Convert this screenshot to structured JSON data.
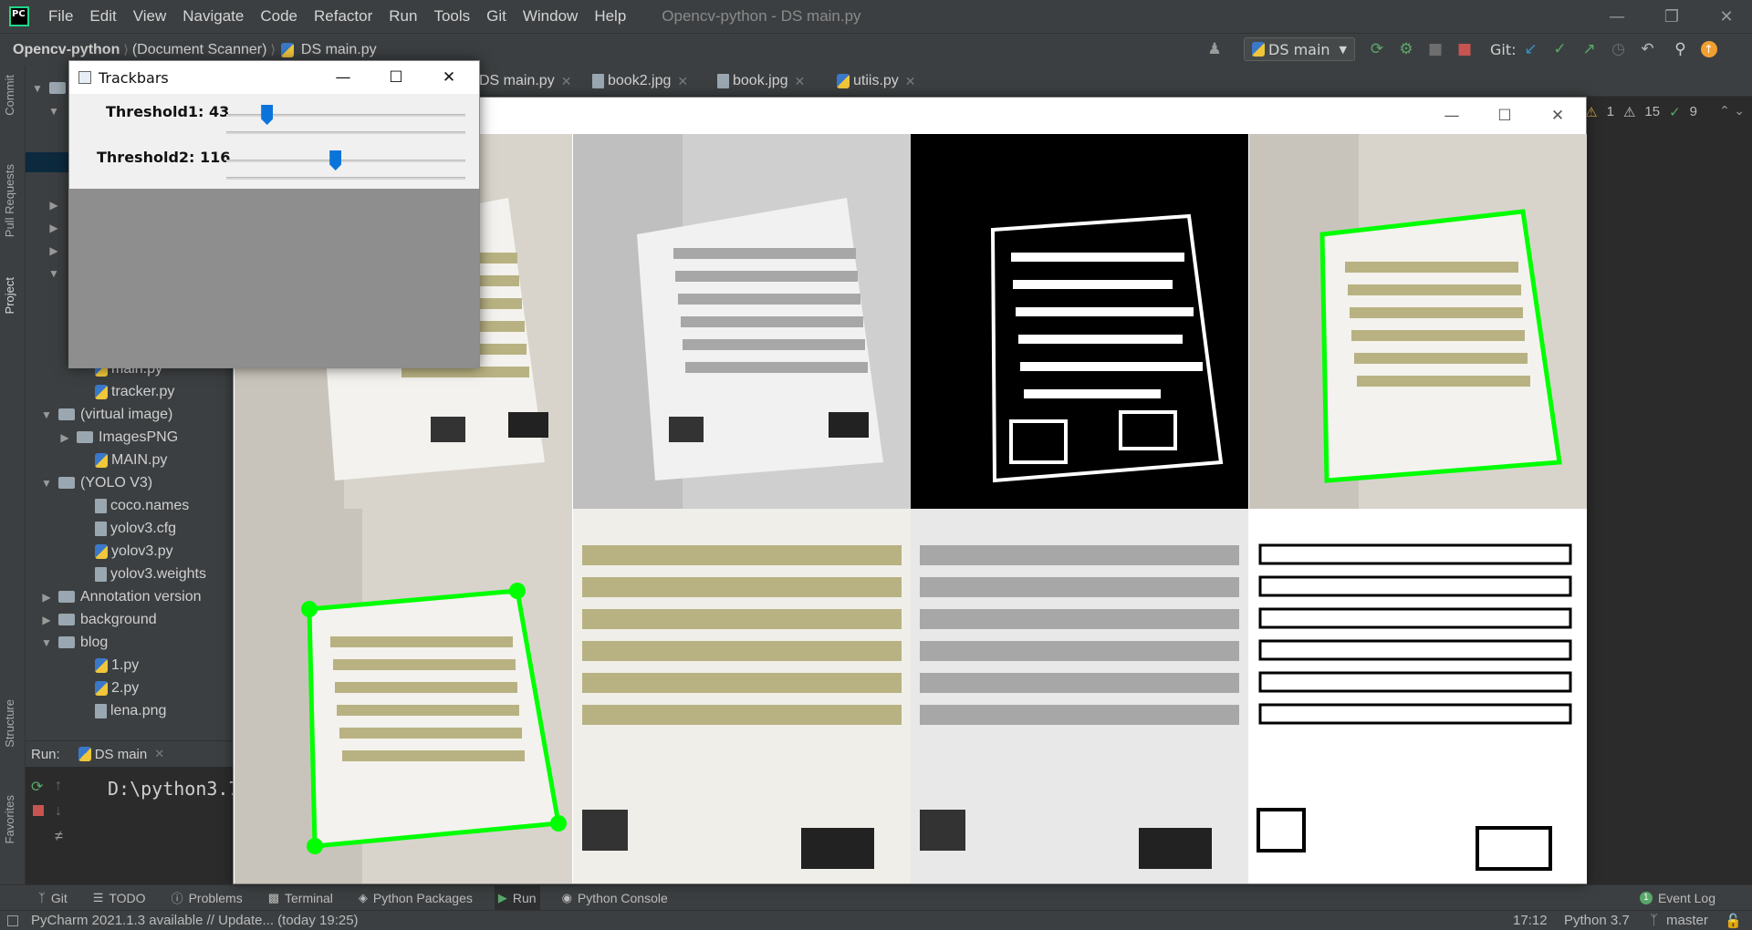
{
  "menubar": {
    "items": [
      "File",
      "Edit",
      "View",
      "Navigate",
      "Code",
      "Refactor",
      "Run",
      "Tools",
      "Git",
      "Window",
      "Help"
    ],
    "title": "Opencv-python - DS main.py"
  },
  "navbar": {
    "crumbs": [
      "Opencv-python",
      "(Document Scanner)",
      "DS main.py"
    ],
    "run_config": "DS main",
    "git_label": "Git:"
  },
  "left_stripe": [
    "Commit",
    "Pull Requests",
    "Project",
    "Structure",
    "Favorites"
  ],
  "tree": {
    "items": [
      {
        "label": "main.py",
        "type": "py",
        "indent": 2
      },
      {
        "label": "tracker.py",
        "type": "py",
        "indent": 2
      },
      {
        "label": "(virtual image)",
        "type": "folder",
        "indent": 1,
        "open": true
      },
      {
        "label": "ImagesPNG",
        "type": "folder",
        "indent": 2,
        "open": false
      },
      {
        "label": "MAIN.py",
        "type": "py",
        "indent": 2
      },
      {
        "label": "(YOLO V3)",
        "type": "folder",
        "indent": 1,
        "open": true
      },
      {
        "label": "coco.names",
        "type": "file",
        "indent": 2
      },
      {
        "label": "yolov3.cfg",
        "type": "file",
        "indent": 2
      },
      {
        "label": "yolov3.py",
        "type": "py",
        "indent": 2
      },
      {
        "label": "yolov3.weights",
        "type": "file",
        "indent": 2
      },
      {
        "label": "Annotation version",
        "type": "folder",
        "indent": 1,
        "open": false
      },
      {
        "label": "background",
        "type": "folder",
        "indent": 1,
        "open": false
      },
      {
        "label": "blog",
        "type": "folder",
        "indent": 1,
        "open": true
      },
      {
        "label": "1.py",
        "type": "py",
        "indent": 2
      },
      {
        "label": "2.py",
        "type": "py",
        "indent": 2
      },
      {
        "label": "lena.png",
        "type": "file",
        "indent": 2
      }
    ]
  },
  "tabs": [
    {
      "label": "DS main.py",
      "active": true
    },
    {
      "label": "book2.jpg",
      "active": false
    },
    {
      "label": "book.jpg",
      "active": false
    },
    {
      "label": "utiis.py",
      "active": false
    }
  ],
  "inspections": {
    "warn1": "1",
    "warn2": "15",
    "ok": "9"
  },
  "run": {
    "label": "Run:",
    "config": "DS main",
    "output": "D:\\python3.7\\p"
  },
  "bottom_tools": [
    "Git",
    "TODO",
    "Problems",
    "Terminal",
    "Python Packages",
    "Run",
    "Python Console"
  ],
  "event_log": "Event Log",
  "status": {
    "message": "PyCharm 2021.1.3 available // Update... (today 19:25)",
    "position": "17:12",
    "interpreter": "Python 3.7",
    "branch": "master"
  },
  "trackbars": {
    "title": "Trackbars",
    "t1_label": "Threshold1: 43",
    "t2_label": "Threshold2: 116",
    "t1_value": 43,
    "t2_value": 116,
    "max": 255
  }
}
